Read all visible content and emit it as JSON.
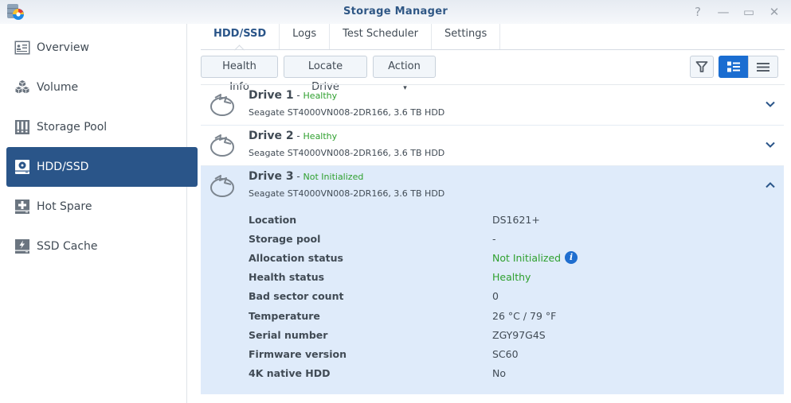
{
  "window": {
    "title": "Storage Manager",
    "controls": {
      "help_icon": "?",
      "minimize_icon": "—",
      "maximize_icon": "▭",
      "close_icon": "✕"
    }
  },
  "sidebar": {
    "items": [
      {
        "label": "Overview",
        "icon": "overview-icon",
        "active": false
      },
      {
        "label": "Volume",
        "icon": "volume-icon",
        "active": false
      },
      {
        "label": "Storage Pool",
        "icon": "storage-pool-icon",
        "active": false
      },
      {
        "label": "HDD/SSD",
        "icon": "hdd-icon",
        "active": true
      },
      {
        "label": "Hot Spare",
        "icon": "hot-spare-icon",
        "active": false
      },
      {
        "label": "SSD Cache",
        "icon": "ssd-cache-icon",
        "active": false
      }
    ]
  },
  "tabs": [
    {
      "label": "HDD/SSD",
      "active": true
    },
    {
      "label": "Logs",
      "active": false
    },
    {
      "label": "Test Scheduler",
      "active": false
    },
    {
      "label": "Settings",
      "active": false
    }
  ],
  "toolbar": {
    "health_info": "Health Info",
    "locate_drive": "Locate Drive",
    "action": "Action",
    "action_caret": "▾",
    "view_mode": "detail-list"
  },
  "colors": {
    "accent": "#2a5589",
    "healthy": "#2fa02f",
    "expanded_bg": "#dfebfa",
    "view_active": "#1a6dd1"
  },
  "drives": [
    {
      "name": "Drive 1",
      "sep": " - ",
      "status": "Healthy",
      "description": "Seagate ST4000VN008-2DR166, 3.6 TB HDD",
      "expanded": false
    },
    {
      "name": "Drive 2",
      "sep": " - ",
      "status": "Healthy",
      "description": "Seagate ST4000VN008-2DR166, 3.6 TB HDD",
      "expanded": false
    },
    {
      "name": "Drive 3",
      "sep": " - ",
      "status": "Not Initialized",
      "description": "Seagate ST4000VN008-2DR166, 3.6 TB HDD",
      "expanded": true,
      "details": [
        {
          "label": "Location",
          "value": "DS1621+"
        },
        {
          "label": "Storage pool",
          "value": "-"
        },
        {
          "label": "Allocation status",
          "value": "Not Initialized",
          "status": true,
          "info": true
        },
        {
          "label": "Health status",
          "value": "Healthy",
          "status": true
        },
        {
          "label": "Bad sector count",
          "value": "0"
        },
        {
          "label": "Temperature",
          "value": "26 °C / 79 °F"
        },
        {
          "label": "Serial number",
          "value": "ZGY97G4S"
        },
        {
          "label": "Firmware version",
          "value": "SC60"
        },
        {
          "label": "4K native HDD",
          "value": "No"
        }
      ]
    }
  ]
}
